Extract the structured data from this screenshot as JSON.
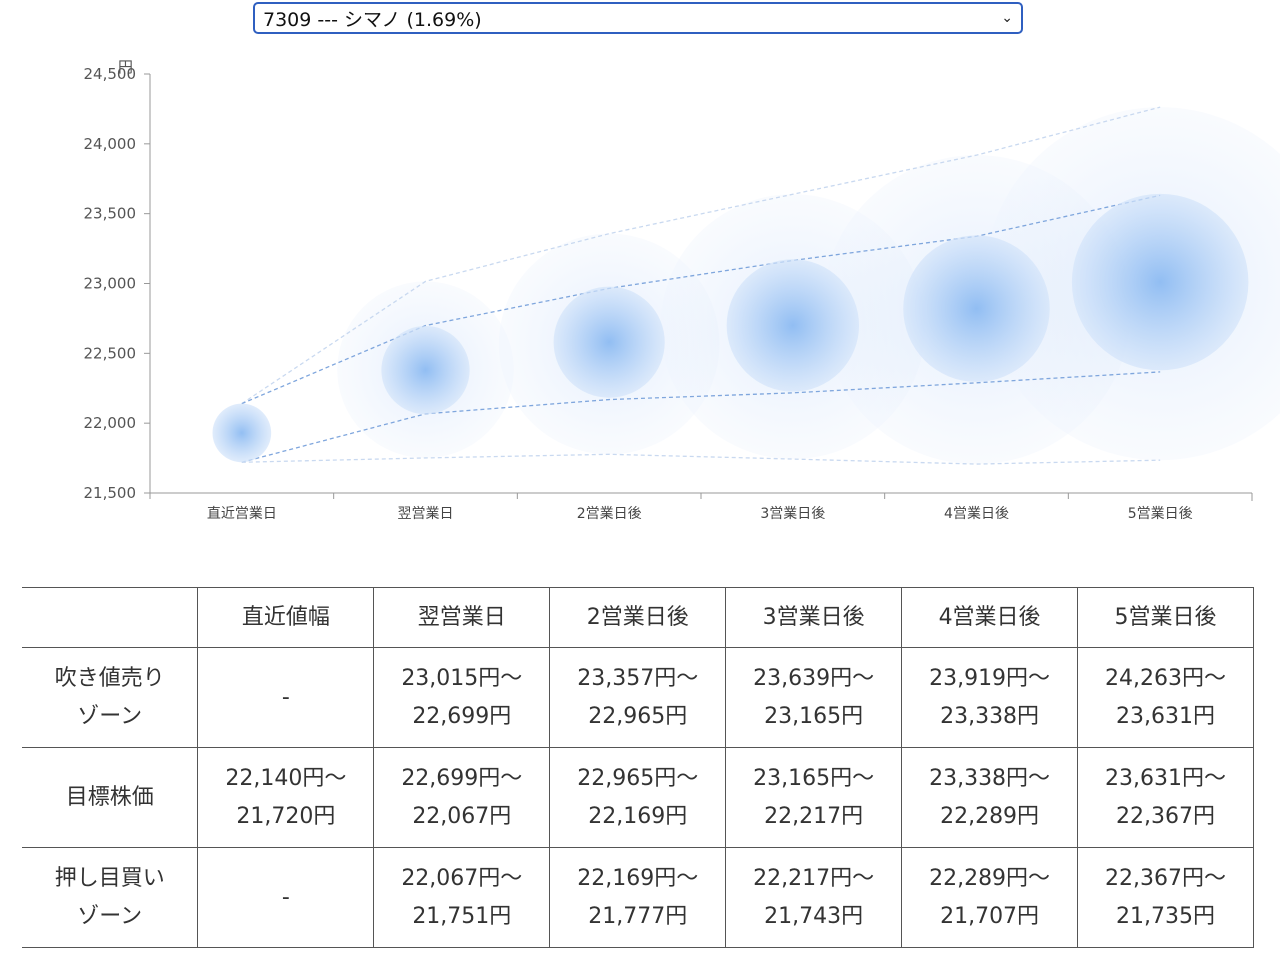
{
  "selector": {
    "value": "7309 --- シマノ (1.69%)"
  },
  "chart_data": {
    "type": "scatter",
    "yunit": "円",
    "ylim": [
      21500,
      24500
    ],
    "yticks": [
      21500,
      22000,
      22500,
      23000,
      23500,
      24000,
      24500
    ],
    "ytick_labels": [
      "21,500",
      "22,000",
      "22,500",
      "23,000",
      "23,500",
      "24,000",
      "24,500"
    ],
    "categories": [
      "直近営業日",
      "翌営業日",
      "2営業日後",
      "3営業日後",
      "4営業日後",
      "5営業日後"
    ],
    "center": [
      21930,
      22380,
      22580,
      22700,
      22820,
      23010
    ],
    "upper_band": [
      22140,
      22699,
      22965,
      23165,
      23338,
      23631
    ],
    "lower_band": [
      21720,
      22067,
      22169,
      22217,
      22289,
      22367
    ],
    "upper_outer": [
      21720,
      23015,
      23357,
      23639,
      23919,
      24263
    ],
    "lower_outer": [
      21720,
      21751,
      21777,
      21743,
      21707,
      21735
    ],
    "grid": false,
    "legend": "none"
  },
  "table": {
    "headers": [
      "",
      "直近値幅",
      "翌営業日",
      "2営業日後",
      "3営業日後",
      "4営業日後",
      "5営業日後"
    ],
    "rows": [
      {
        "label": [
          "吹き値売り",
          "ゾーン"
        ],
        "cells": [
          [
            "-"
          ],
          [
            "23,015円〜",
            "22,699円"
          ],
          [
            "23,357円〜",
            "22,965円"
          ],
          [
            "23,639円〜",
            "23,165円"
          ],
          [
            "23,919円〜",
            "23,338円"
          ],
          [
            "24,263円〜",
            "23,631円"
          ]
        ]
      },
      {
        "label": [
          "目標株価"
        ],
        "cells": [
          [
            "22,140円〜",
            "21,720円"
          ],
          [
            "22,699円〜",
            "22,067円"
          ],
          [
            "22,965円〜",
            "22,169円"
          ],
          [
            "23,165円〜",
            "22,217円"
          ],
          [
            "23,338円〜",
            "22,289円"
          ],
          [
            "23,631円〜",
            "22,367円"
          ]
        ]
      },
      {
        "label": [
          "押し目買い",
          "ゾーン"
        ],
        "cells": [
          [
            "-"
          ],
          [
            "22,067円〜",
            "21,751円"
          ],
          [
            "22,169円〜",
            "21,777円"
          ],
          [
            "22,217円〜",
            "21,743円"
          ],
          [
            "22,289円〜",
            "21,707円"
          ],
          [
            "22,367円〜",
            "21,735円"
          ]
        ]
      }
    ]
  }
}
